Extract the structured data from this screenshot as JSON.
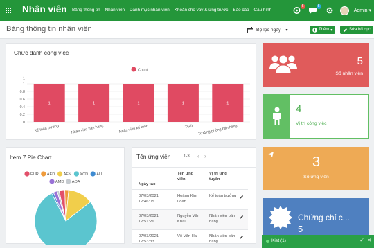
{
  "app": {
    "title": "Nhân viên"
  },
  "nav": {
    "menu": [
      "Bảng thông tin",
      "Nhân viên",
      "Danh mục nhân viên",
      "Khoản cho vay & ứng trước",
      "Báo cáo",
      "Cấu hình"
    ],
    "badge_1": "5",
    "badge_2": "5",
    "user": "Admin"
  },
  "header": {
    "page_title": "Bảng thông tin nhân viên",
    "filter_label": "Bộ lọc ngày",
    "add_label": "Thêm",
    "edit_layout_label": "Sửa bố cục"
  },
  "job_titles": {
    "title": "Chức danh công việc",
    "chart_data": {
      "type": "bar",
      "legend_label": "Count",
      "categories": [
        "Kế toán trưởng",
        "Nhân viên bán hàng",
        "Nhân viên kế toán",
        "TGĐ",
        "Trưởng phòng bán hàng"
      ],
      "values": [
        1,
        1,
        1,
        1,
        1
      ],
      "data_labels": [
        "1",
        "1",
        "1",
        "1",
        "1"
      ],
      "y_ticks": [
        "1",
        "1",
        "0.8",
        "0.6",
        "0.4",
        "0.2",
        "0"
      ],
      "ylim": [
        0,
        1.2
      ],
      "color": "#e04a62"
    }
  },
  "pie": {
    "title": "Item 7 Pie Chart",
    "chart_data": {
      "type": "pie",
      "labels": [
        "EUR",
        "AED",
        "AFN",
        "XCD",
        "ALL",
        "AMD",
        "AOA"
      ],
      "values": [
        3,
        2,
        13,
        78,
        1,
        2,
        1
      ],
      "colors": [
        "#e2506a",
        "#ef9b3b",
        "#f1ce4b",
        "#5bc5cf",
        "#3f8bd1",
        "#9a72d6",
        "#c6cbd0"
      ]
    }
  },
  "applicants": {
    "title": "Tên ứng viên",
    "pager": "1-3",
    "columns": [
      "Ngày tạo",
      "Tên ứng viên",
      "Vị trí ứng tuyển"
    ],
    "rows": [
      {
        "date": "07/03/2021",
        "time": "12:46:05",
        "name_1": "Hoàng Kim",
        "name_2": "Loan",
        "pos_1": "Kế toán trưởng",
        "pos_2": ""
      },
      {
        "date": "07/03/2021",
        "time": "12:51:26",
        "name_1": "Nguyễn Văn",
        "name_2": "Khải",
        "pos_1": "Nhân viên bán",
        "pos_2": "hàng"
      },
      {
        "date": "07/03/2021",
        "time": "12:53:33",
        "name_1": "Võ Văn Hai",
        "name_2": "",
        "pos_1": "Nhân viên bán",
        "pos_2": "hàng"
      }
    ]
  },
  "stats": {
    "employees": {
      "value": "5",
      "label": "Số nhân viên",
      "color": "#e05b5b"
    },
    "positions": {
      "value": "4",
      "label": "Vị trí công việc",
      "color": "#62bf64"
    },
    "applicants": {
      "value": "3",
      "label": "Số ứng viên",
      "color": "#eeaa55"
    },
    "certs": {
      "value": "5",
      "label": "Chứng chỉ c...",
      "color": "#4f80c0"
    }
  },
  "chat": {
    "label": "Kiet (1)"
  }
}
